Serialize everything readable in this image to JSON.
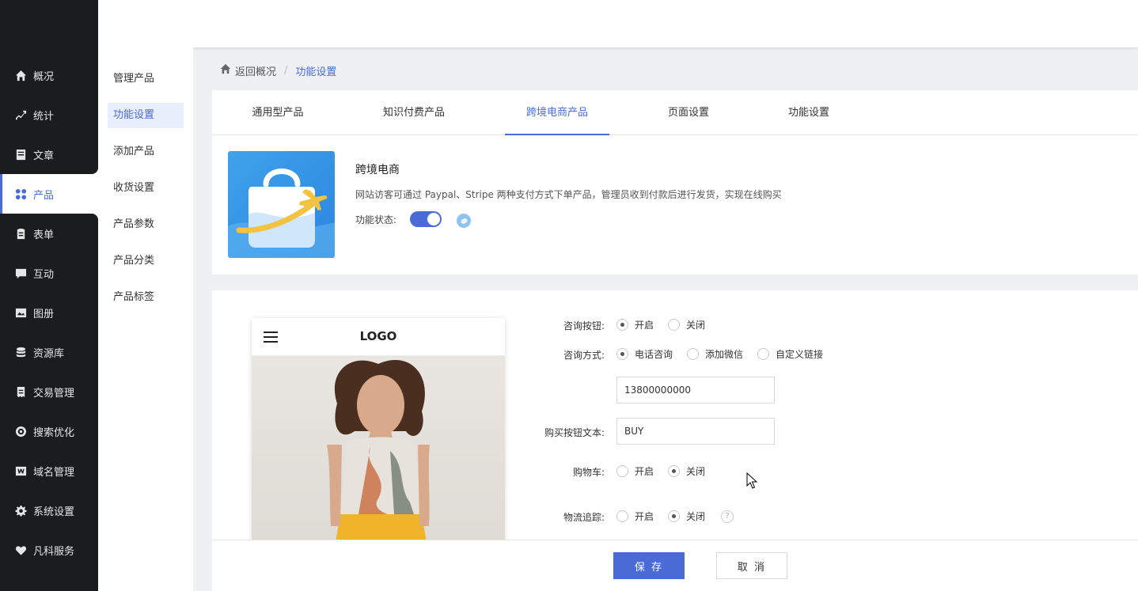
{
  "sidebar": {
    "items": [
      {
        "label": "概况",
        "icon": "home-icon"
      },
      {
        "label": "统计",
        "icon": "chart-icon"
      },
      {
        "label": "文章",
        "icon": "article-icon"
      },
      {
        "label": "产品",
        "icon": "grid-icon"
      },
      {
        "label": "表单",
        "icon": "clipboard-icon"
      },
      {
        "label": "互动",
        "icon": "chat-icon"
      },
      {
        "label": "图册",
        "icon": "image-icon"
      },
      {
        "label": "资源库",
        "icon": "database-icon"
      },
      {
        "label": "交易管理",
        "icon": "receipt-icon"
      },
      {
        "label": "搜索优化",
        "icon": "seo-icon"
      },
      {
        "label": "域名管理",
        "icon": "domain-icon"
      },
      {
        "label": "系统设置",
        "icon": "gear-icon"
      },
      {
        "label": "凡科服务",
        "icon": "heart-icon"
      }
    ],
    "active_index": 3
  },
  "submenu": {
    "items": [
      "管理产品",
      "功能设置",
      "添加产品",
      "收货设置",
      "产品参数",
      "产品分类",
      "产品标签"
    ],
    "active_index": 1
  },
  "breadcrumb": {
    "back_label": "返回概况",
    "separator": "/",
    "current": "功能设置"
  },
  "tabs": {
    "items": [
      "通用型产品",
      "知识付费产品",
      "跨境电商产品",
      "页面设置",
      "功能设置"
    ],
    "active_index": 2
  },
  "feature": {
    "title": "跨境电商",
    "description": "网站访客可通过 Paypal、Stripe 两种支付方式下单产品，管理员收到付款后进行发货，实现在线购买",
    "status_label": "功能状态:",
    "enabled": true
  },
  "preview": {
    "logo": "LOGO"
  },
  "form": {
    "consult_button": {
      "label": "咨询按钮:",
      "options": [
        "开启",
        "关闭"
      ],
      "selected": 0
    },
    "consult_method": {
      "label": "咨询方式:",
      "options": [
        "电话咨询",
        "添加微信",
        "自定义链接"
      ],
      "selected": 0
    },
    "phone_value": "13800000000",
    "buy_text": {
      "label": "购买按钮文本:",
      "value": "BUY"
    },
    "cart": {
      "label": "购物车:",
      "options": [
        "开启",
        "关闭"
      ],
      "selected": 1
    },
    "logistics": {
      "label": "物流追踪:",
      "options": [
        "开启",
        "关闭"
      ],
      "selected": 1,
      "help": "?"
    }
  },
  "footer": {
    "save_label": "保 存",
    "cancel_label": "取 消"
  },
  "colors": {
    "accent": "#4a6bd6",
    "sidebar_bg": "#1b1c1d"
  }
}
